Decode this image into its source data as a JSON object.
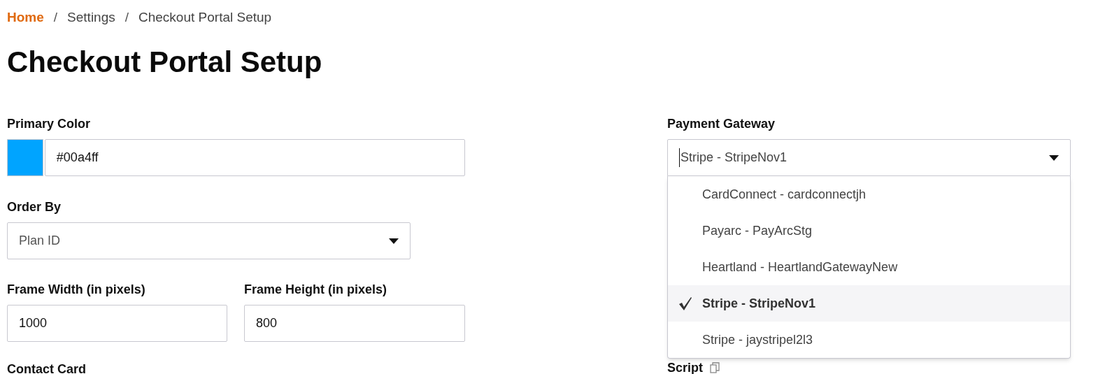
{
  "breadcrumb": [
    {
      "label": "Home",
      "kind": "home"
    },
    {
      "label": "Settings",
      "kind": "crumb"
    },
    {
      "label": "Checkout Portal Setup",
      "kind": "crumb"
    }
  ],
  "separator": "/",
  "title": "Checkout Portal Setup",
  "primary_color": {
    "label": "Primary Color",
    "value": "#00a4ff",
    "color": "#00a4ff"
  },
  "order_by": {
    "label": "Order By",
    "value": "Plan ID"
  },
  "frame_width": {
    "label": "Frame Width (in pixels)",
    "value": "1000"
  },
  "frame_height": {
    "label": "Frame Height (in pixels)",
    "value": "800"
  },
  "contact_card": {
    "label": "Contact Card"
  },
  "payment_gateway": {
    "label": "Payment Gateway",
    "value": "Stripe - StripeNov1",
    "expanded": true,
    "options": [
      {
        "label": "CardConnect - cardconnectjh",
        "selected": false
      },
      {
        "label": "Payarc - PayArcStg",
        "selected": false
      },
      {
        "label": "Heartland - HeartlandGatewayNew",
        "selected": false
      },
      {
        "label": "Stripe - StripeNov1",
        "selected": true
      },
      {
        "label": "Stripe - jaystripel2l3",
        "selected": false
      }
    ]
  },
  "script": {
    "label": "Script"
  }
}
